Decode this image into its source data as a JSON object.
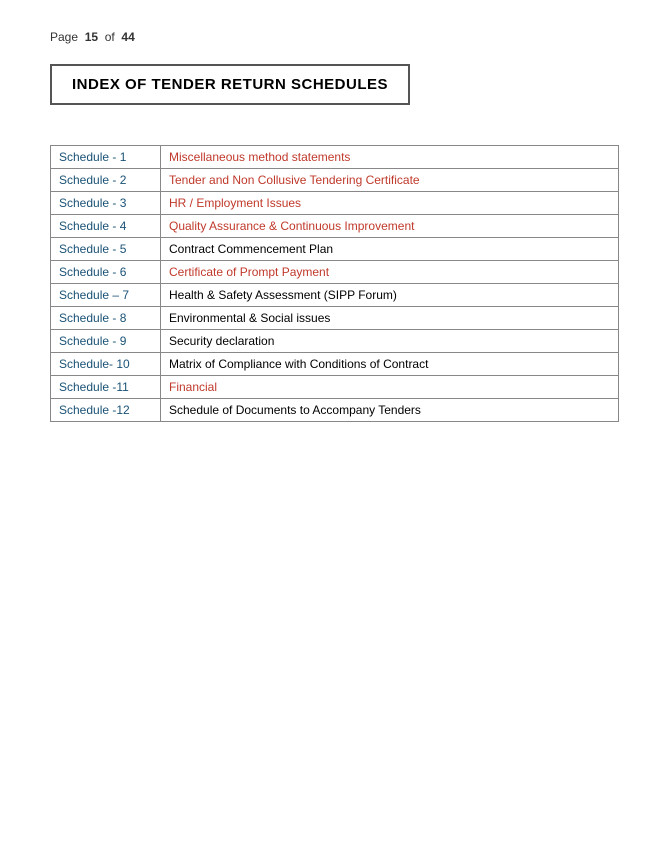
{
  "page": {
    "current": "15",
    "total": "44",
    "page_label": "Page",
    "of_label": "of"
  },
  "title": "INDEX OF TENDER RETURN SCHEDULES",
  "schedules": [
    {
      "id": "Schedule - 1",
      "description": "Miscellaneous method statements",
      "style": "blue"
    },
    {
      "id": "Schedule - 2",
      "description": "Tender and Non Collusive Tendering Certificate",
      "style": "blue"
    },
    {
      "id": "Schedule - 3",
      "description": "HR / Employment Issues",
      "style": "blue"
    },
    {
      "id": "Schedule - 4",
      "description": "Quality Assurance & Continuous Improvement",
      "style": "blue"
    },
    {
      "id": "Schedule - 5",
      "description": "Contract Commencement Plan",
      "style": "black"
    },
    {
      "id": "Schedule - 6",
      "description": "Certificate of Prompt Payment",
      "style": "blue"
    },
    {
      "id": "Schedule – 7",
      "description": "Health & Safety Assessment (SIPP Forum)",
      "style": "black"
    },
    {
      "id": "Schedule - 8",
      "description": "Environmental & Social issues",
      "style": "black"
    },
    {
      "id": "Schedule - 9",
      "description": "Security declaration",
      "style": "black"
    },
    {
      "id": "Schedule- 10",
      "description": "Matrix of Compliance with Conditions of Contract",
      "style": "black"
    },
    {
      "id": "Schedule -11",
      "description": "Financial",
      "style": "blue"
    },
    {
      "id": "Schedule -12",
      "description": "Schedule of Documents to Accompany Tenders",
      "style": "black"
    }
  ]
}
